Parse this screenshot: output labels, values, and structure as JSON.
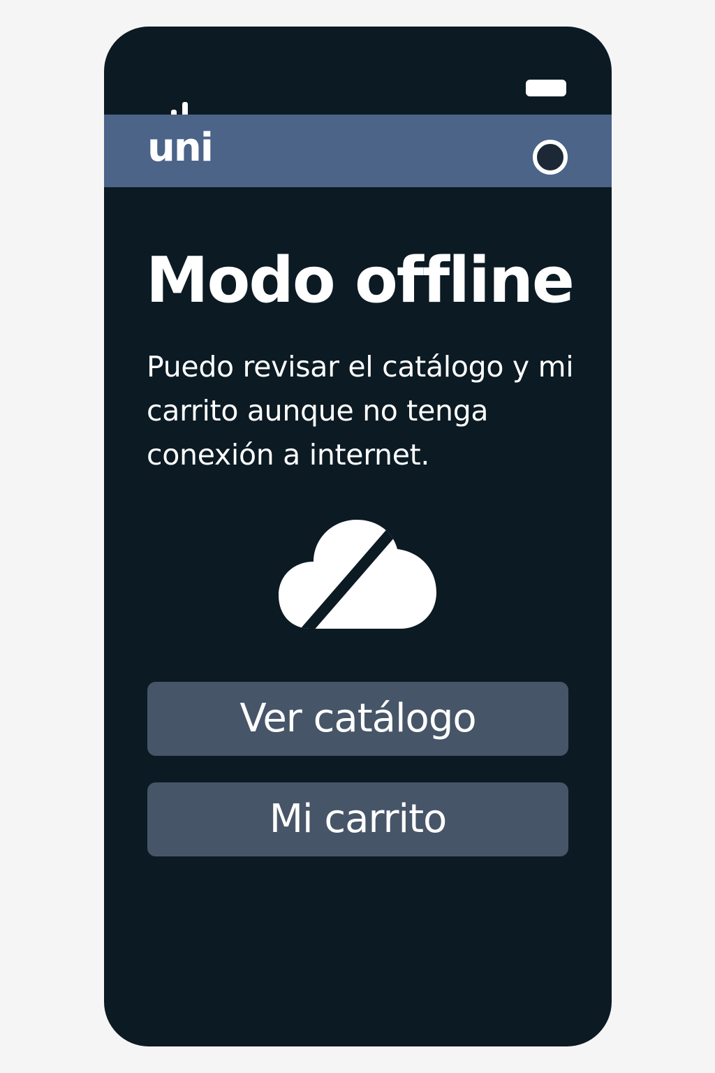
{
  "status_bar": {
    "signal_icon": "signal-bars-icon",
    "battery_icon": "battery-icon"
  },
  "app_bar": {
    "logo": "uni",
    "profile_icon": "profile-circle-icon",
    "background_color": "#4b6488"
  },
  "main": {
    "title": "Modo offline",
    "description": "Puedo revisar el catálogo y mi carrito aunque no tenga conexión a internet.",
    "illustration_icon": "cloud-off-icon"
  },
  "actions": {
    "catalog_label": "Ver catálogo",
    "cart_label": "Mi carrito",
    "button_color": "#465567"
  },
  "theme": {
    "background": "#0b1a23",
    "text_color": "#ffffff"
  }
}
